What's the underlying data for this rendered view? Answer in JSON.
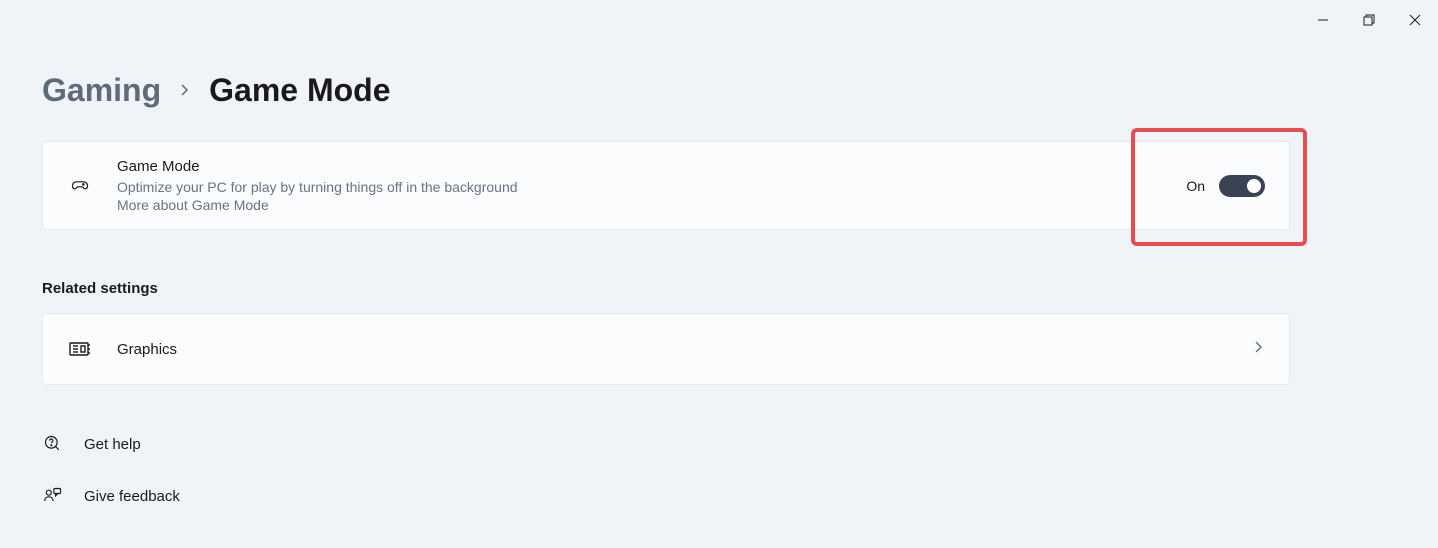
{
  "breadcrumb": {
    "parent": "Gaming",
    "current": "Game Mode"
  },
  "gameMode": {
    "title": "Game Mode",
    "subtitle": "Optimize your PC for play by turning things off in the background",
    "moreLink": "More about Game Mode",
    "toggleLabel": "On",
    "toggleState": true
  },
  "relatedSettings": {
    "header": "Related settings",
    "items": [
      {
        "label": "Graphics"
      }
    ]
  },
  "bottomLinks": {
    "help": "Get help",
    "feedback": "Give feedback"
  }
}
